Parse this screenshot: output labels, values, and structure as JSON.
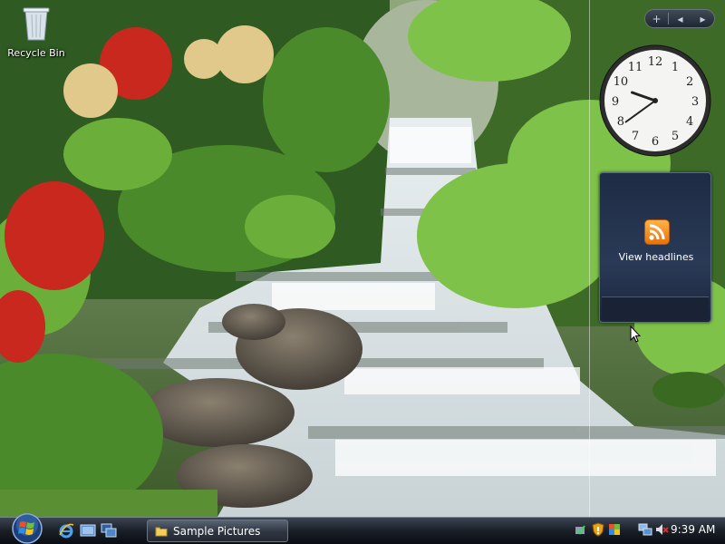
{
  "desktop": {
    "icons": [
      {
        "label": "Recycle Bin",
        "icon": "recycle-bin-icon"
      }
    ]
  },
  "sidebar": {
    "controls": {
      "add": "+",
      "prev": "◂",
      "next": "▸"
    },
    "clock": {
      "hour": 9,
      "minute": 39
    },
    "feed": {
      "label": "View headlines",
      "icon": "rss-icon"
    }
  },
  "taskbar": {
    "start_icon": "windows-orb-icon",
    "quick_launch": [
      "internet-explorer-icon",
      "show-desktop-icon",
      "switch-windows-icon"
    ],
    "tasks": [
      {
        "label": "Sample Pictures",
        "icon": "folder-icon"
      }
    ],
    "tray_icons": [
      "safely-remove-icon",
      "security-shield-icon",
      "windows-update-icon",
      "network-icon",
      "volume-muted-icon"
    ],
    "time": "9:39 AM"
  },
  "colors": {
    "taskbar": "#1a1f27",
    "feed_bg": "#2a3a56",
    "rss": "#f08a1c"
  }
}
